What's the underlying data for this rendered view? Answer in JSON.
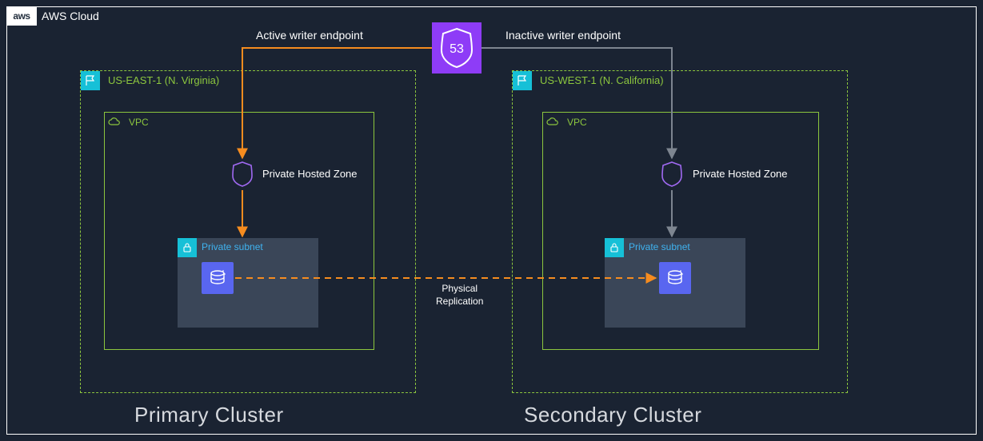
{
  "cloud": {
    "label": "AWS Cloud",
    "logo_text": "aws"
  },
  "route53": {
    "number": "53"
  },
  "endpoints": {
    "active_label": "Active writer endpoint",
    "inactive_label": "Inactive writer endpoint"
  },
  "regions": {
    "primary": {
      "label": "US-EAST-1 (N. Virginia)",
      "vpc_label": "VPC",
      "subnet_label": "Private subnet",
      "phz_label": "Private Hosted Zone",
      "cluster_label": "Primary Cluster"
    },
    "secondary": {
      "label": "US-WEST-1 (N. California)",
      "vpc_label": "VPC",
      "subnet_label": "Private subnet",
      "phz_label": "Private Hosted Zone",
      "cluster_label": "Secondary Cluster"
    }
  },
  "replication_label_line1": "Physical",
  "replication_label_line2": "Replication",
  "colors": {
    "bg": "#1a2332",
    "green": "#8cc63e",
    "teal": "#16c0d7",
    "purple": "#8e3cf7",
    "orange": "#f68c1f",
    "grey_arrow": "#7d8590",
    "db_blue": "#5966f0"
  }
}
